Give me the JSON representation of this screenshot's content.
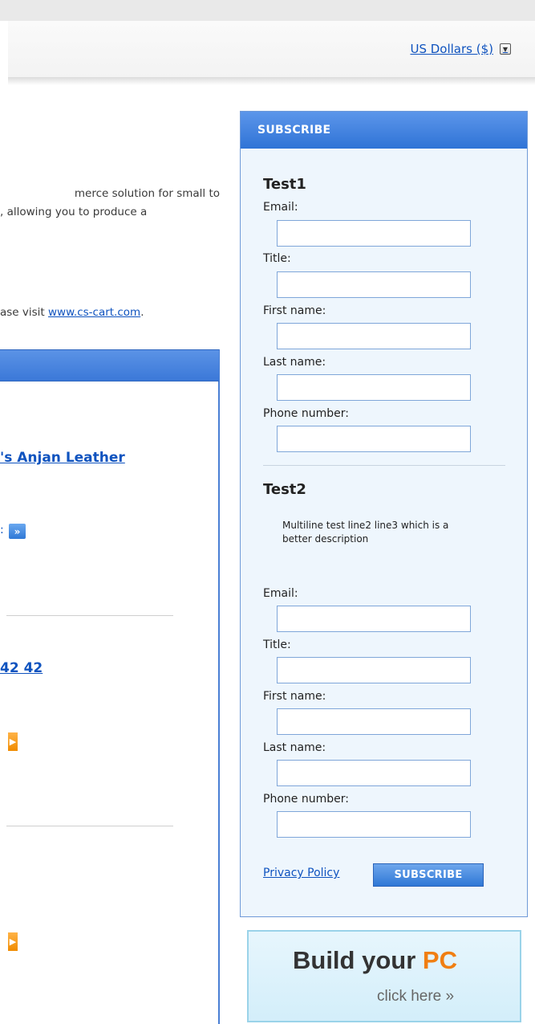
{
  "header": {
    "currency_label": "US Dollars ($)"
  },
  "intro": {
    "line1": "merce solution for small to",
    "line2": ", allowing you to produce a",
    "visit_prefix": "ase visit ",
    "visit_link": "www.cs-cart.com",
    "visit_suffix": "."
  },
  "left_panel": {
    "product1_link": "'s Anjan Leather",
    "product1_more": ":",
    "product2_link": "42 42"
  },
  "subscribe": {
    "header": "SUBSCRIBE",
    "list1": {
      "title": "Test1",
      "email": "Email:",
      "title_field": "Title:",
      "first_name": "First name:",
      "last_name": "Last name:",
      "phone": "Phone number:"
    },
    "list2": {
      "title": "Test2",
      "description": "Multiline test line2 line3 which is a better description",
      "email": "Email:",
      "title_field": "Title:",
      "first_name": "First name:",
      "last_name": "Last name:",
      "phone": "Phone number:"
    },
    "privacy_policy": "Privacy Policy",
    "subscribe_button": "SUBSCRIBE"
  },
  "banner": {
    "title_main": "Build your ",
    "title_accent": "PC",
    "click": "click here »"
  }
}
